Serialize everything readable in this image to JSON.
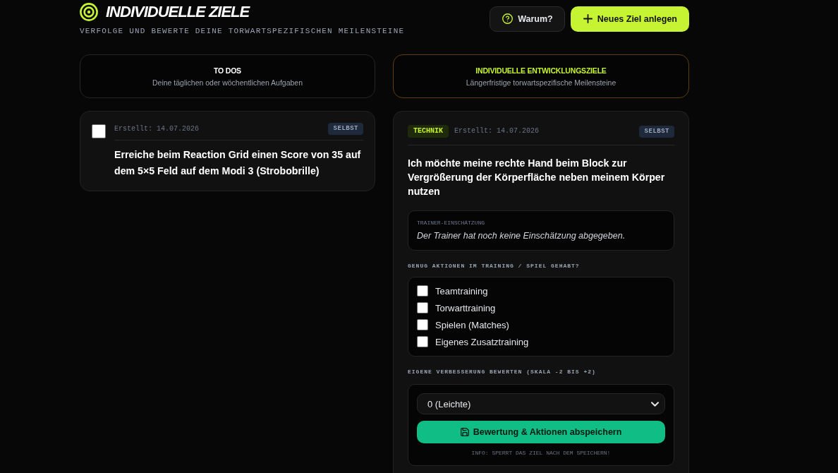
{
  "header": {
    "title": "INDIVIDUELLE ZIELE",
    "subtitle": "VERFOLGE UND BEWERTE DEINE TORWARTSPEZIFISCHEN MEILENSTEINE",
    "buttons": [
      {
        "label": "Warum?",
        "kind": "secondary"
      },
      {
        "label": "Neues Ziel anlegen",
        "kind": "primary"
      }
    ]
  },
  "sections": [
    {
      "title": "TO DOS",
      "subtitle": "Deine täglichen oder wöchentlichen Aufgaben",
      "kind": "todo"
    },
    {
      "title": "INDIVIDUELLE ENTWICKLUNGSZIELE",
      "subtitle": "Längerfristige torwartspezifische Meilensteine",
      "kind": "goal"
    }
  ],
  "todos": [
    {
      "checked": false,
      "created": "Erstellt: 14.07.2026",
      "badge": "SELBST",
      "text": "Erreiche beim Reaction Grid einen Score von 35 auf dem 5×5 Feld auf dem Modi 3 (Strobobrille)"
    }
  ],
  "goals": [
    {
      "tag": "TECHNIK",
      "created": "Erstellt: 14.07.2026",
      "badge": "SELBST",
      "text": "Ich möchte meine rechte Hand beim Block zur Vergrößerung der Körperfläche neben meinem Körper nutzen",
      "trainer_assessment": {
        "label": "TRAINER-EINSCHÄTZUNG",
        "text": "Der Trainer hat noch keine Einschätzung abgegeben."
      },
      "actions": {
        "label": "GENUG AKTIONEN IM TRAINING / SPIEL GEHABT?",
        "items": [
          {
            "label": "Teamtraining",
            "checked": false
          },
          {
            "label": "Torwarttraining",
            "checked": false
          },
          {
            "label": "Spielen (Matches)",
            "checked": false
          },
          {
            "label": "Eigenes Zusatztraining",
            "checked": false
          }
        ]
      },
      "rating": {
        "label": "EIGENE VERBESSERUNG BEWERTEN (SKALA -2 BIS +2)",
        "value": "0 (Leichte)",
        "save_button": "Bewertung & Aktionen abspeichern",
        "info": "INFO: SPERRT DAS ZIEL NACH DEM SPEICHERN!"
      }
    }
  ]
}
